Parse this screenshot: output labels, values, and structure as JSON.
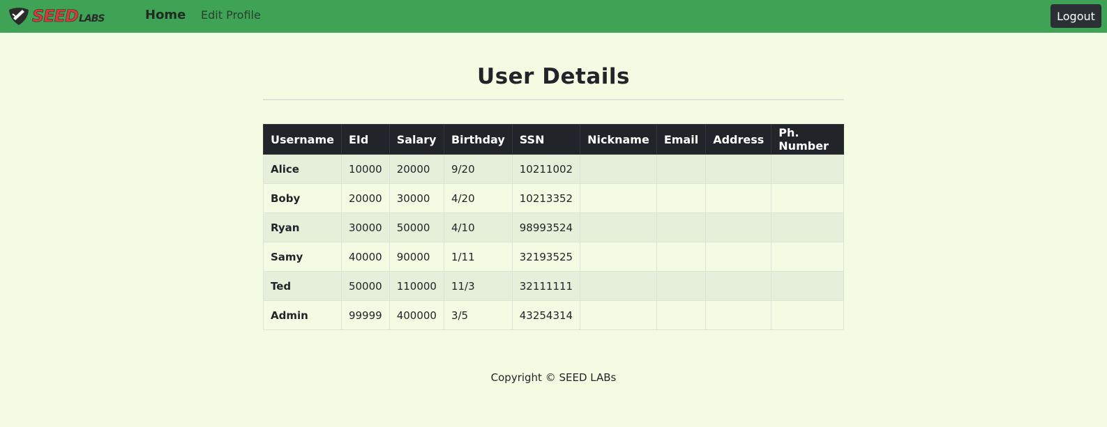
{
  "navbar": {
    "logo_main": "SEED",
    "logo_sub": "LABS",
    "logo_icon": "seed-shield-icon",
    "home_label": "Home",
    "edit_profile_label": "Edit Profile",
    "logout_label": "Logout",
    "bg_color": "#3fa355"
  },
  "page": {
    "title": "User Details",
    "bg_color": "#f3fce3"
  },
  "table": {
    "columns": [
      "Username",
      "EId",
      "Salary",
      "Birthday",
      "SSN",
      "Nickname",
      "Email",
      "Address",
      "Ph. Number"
    ],
    "rows": [
      [
        "Alice",
        "10000",
        "20000",
        "9/20",
        "10211002",
        "",
        "",
        "",
        ""
      ],
      [
        "Boby",
        "20000",
        "30000",
        "4/20",
        "10213352",
        "",
        "",
        "",
        ""
      ],
      [
        "Ryan",
        "30000",
        "50000",
        "4/10",
        "98993524",
        "",
        "",
        "",
        ""
      ],
      [
        "Samy",
        "40000",
        "90000",
        "1/11",
        "32193525",
        "",
        "",
        "",
        ""
      ],
      [
        "Ted",
        "50000",
        "110000",
        "11/3",
        "32111111",
        "",
        "",
        "",
        ""
      ],
      [
        "Admin",
        "99999",
        "400000",
        "3/5",
        "43254314",
        "",
        "",
        "",
        ""
      ]
    ]
  },
  "footer": {
    "text": "Copyright © SEED LABs"
  }
}
